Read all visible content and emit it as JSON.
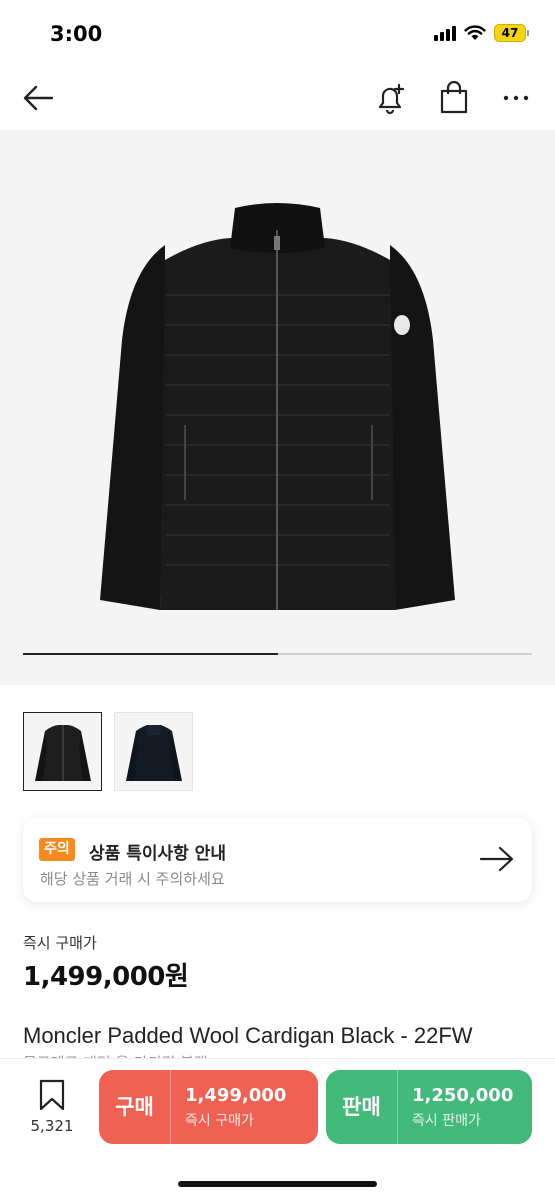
{
  "status_bar": {
    "time": "3:00",
    "battery": "47"
  },
  "gallery": {
    "progress": 0.5,
    "image_count": 2,
    "active_index": 0
  },
  "notice": {
    "badge": "주의",
    "title": "상품 특이사항 안내",
    "subtitle": "해당 상품 거래 시 주의하세요"
  },
  "price": {
    "label": "즉시 구매가",
    "value": "1,499,000원"
  },
  "product": {
    "name": "Moncler Padded Wool Cardigan Black - 22FW",
    "subname": "몽클레르 패딩 울 가디건 블랙"
  },
  "bottom": {
    "bookmark_count": "5,321",
    "buy": {
      "label": "구매",
      "price": "1,499,000",
      "caption": "즉시 구매가"
    },
    "sell": {
      "label": "판매",
      "price": "1,250,000",
      "caption": "즉시 판매가"
    }
  },
  "icons": [
    "back-arrow-icon",
    "bell-plus-icon",
    "shopping-bag-icon",
    "more-icon",
    "arrow-right-icon",
    "bookmark-icon"
  ],
  "colors": {
    "buy": "#ef6253",
    "sell": "#41b979",
    "badge": "#f7891f"
  }
}
